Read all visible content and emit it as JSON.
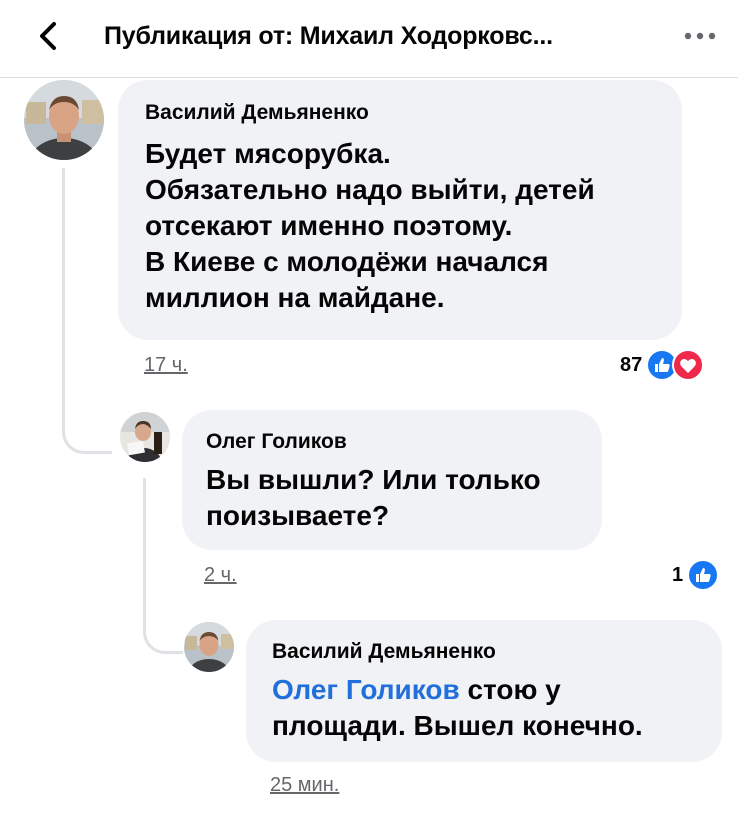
{
  "header": {
    "title": "Публикация от: Михаил Ходорковс..."
  },
  "comments": [
    {
      "author": "Василий Демьяненко",
      "lines": [
        "Будет мясорубка.",
        "Обязательно надо выйти, детей",
        "отсекают именно поэтому.",
        "В Киеве с молодёжи начался",
        "миллион на майдане."
      ],
      "time": "17 ч.",
      "reaction_count": "87",
      "reactions": [
        "like-icon",
        "love-icon"
      ]
    },
    {
      "author": "Олег Голиков",
      "lines": [
        "Вы вышли? Или только",
        "поизываете?"
      ],
      "time": "2 ч.",
      "reaction_count": "1",
      "reactions": [
        "like-icon"
      ]
    },
    {
      "author": "Василий Демьяненко",
      "mention": "Олег Голиков",
      "line1_rest": " стою у",
      "line2": "площади. Вышел конечно.",
      "time": "25 мин."
    }
  ],
  "colors": {
    "bubble": "#f0f2f5",
    "mention": "#216fdb",
    "like": "#1877f2",
    "love": "#f0284a",
    "muted_text": "#65676b"
  }
}
